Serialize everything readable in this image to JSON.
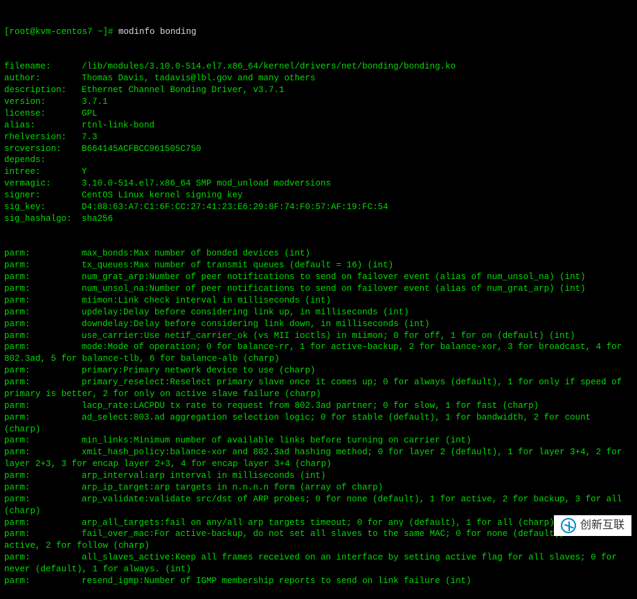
{
  "prompt": {
    "user_host": "[root@kvm-centos7 ~]#",
    "command": "modinfo bonding"
  },
  "fields": [
    {
      "key": "filename:",
      "value": "/lib/modules/3.10.0-514.el7.x86_64/kernel/drivers/net/bonding/bonding.ko"
    },
    {
      "key": "author:",
      "value": "Thomas Davis, tadavis@lbl.gov and many others"
    },
    {
      "key": "description:",
      "value": "Ethernet Channel Bonding Driver, v3.7.1"
    },
    {
      "key": "version:",
      "value": "3.7.1"
    },
    {
      "key": "license:",
      "value": "GPL"
    },
    {
      "key": "alias:",
      "value": "rtnl-link-bond"
    },
    {
      "key": "rhelversion:",
      "value": "7.3"
    },
    {
      "key": "srcversion:",
      "value": "B664145ACFBCC961505C750"
    },
    {
      "key": "depends:",
      "value": ""
    },
    {
      "key": "intree:",
      "value": "Y"
    },
    {
      "key": "vermagic:",
      "value": "3.10.0-514.el7.x86_64 SMP mod_unload modversions"
    },
    {
      "key": "signer:",
      "value": "CentOS Linux kernel signing key"
    },
    {
      "key": "sig_key:",
      "value": "D4:88:63:A7:C1:6F:CC:27:41:23:E6:29:8F:74:F0:57:AF:19:FC:54"
    },
    {
      "key": "sig_hashalgo:",
      "value": "sha256"
    }
  ],
  "parms": [
    "max_bonds:Max number of bonded devices (int)",
    "tx_queues:Max number of transmit queues (default = 16) (int)",
    "num_grat_arp:Number of peer notifications to send on failover event (alias of num_unsol_na) (int)",
    "num_unsol_na:Number of peer notifications to send on failover event (alias of num_grat_arp) (int)",
    "miimon:Link check interval in milliseconds (int)",
    "updelay:Delay before considering link up, in milliseconds (int)",
    "downdelay:Delay before considering link down, in milliseconds (int)",
    "use_carrier:Use netif_carrier_ok (vs MII ioctls) in miimon; 0 for off, 1 for on (default) (int)",
    "mode:Mode of operation; 0 for balance-rr, 1 for active-backup, 2 for balance-xor, 3 for broadcast, 4 for 802.3ad, 5 for balance-tlb, 6 for balance-alb (charp)",
    "primary:Primary network device to use (charp)",
    "primary_reselect:Reselect primary slave once it comes up; 0 for always (default), 1 for only if speed of primary is better, 2 for only on active slave failure (charp)",
    "lacp_rate:LACPDU tx rate to request from 802.3ad partner; 0 for slow, 1 for fast (charp)",
    "ad_select:803.ad aggregation selection logic; 0 for stable (default), 1 for bandwidth, 2 for count (charp)",
    "min_links:Minimum number of available links before turning on carrier (int)",
    "xmit_hash_policy:balance-xor and 802.3ad hashing method; 0 for layer 2 (default), 1 for layer 3+4, 2 for layer 2+3, 3 for encap layer 2+3, 4 for encap layer 3+4 (charp)",
    "arp_interval:arp interval in milliseconds (int)",
    "arp_ip_target:arp targets in n.n.n.n form (array of charp)",
    "arp_validate:validate src/dst of ARP probes; 0 for none (default), 1 for active, 2 for backup, 3 for all (charp)",
    "arp_all_targets:fail on any/all arp targets timeout; 0 for any (default), 1 for all (charp)",
    "fail_over_mac:For active-backup, do not set all slaves to the same MAC; 0 for none (default), 1 for active, 2 for follow (charp)",
    "all_slaves_active:Keep all frames received on an interface by setting active flag for all slaves; 0 for never (default), 1 for always. (int)",
    "resend_igmp:Number of IGMP membership reports to send on link failure (int)"
  ],
  "parm_key": "parm:",
  "watermark_text": "创新互联"
}
